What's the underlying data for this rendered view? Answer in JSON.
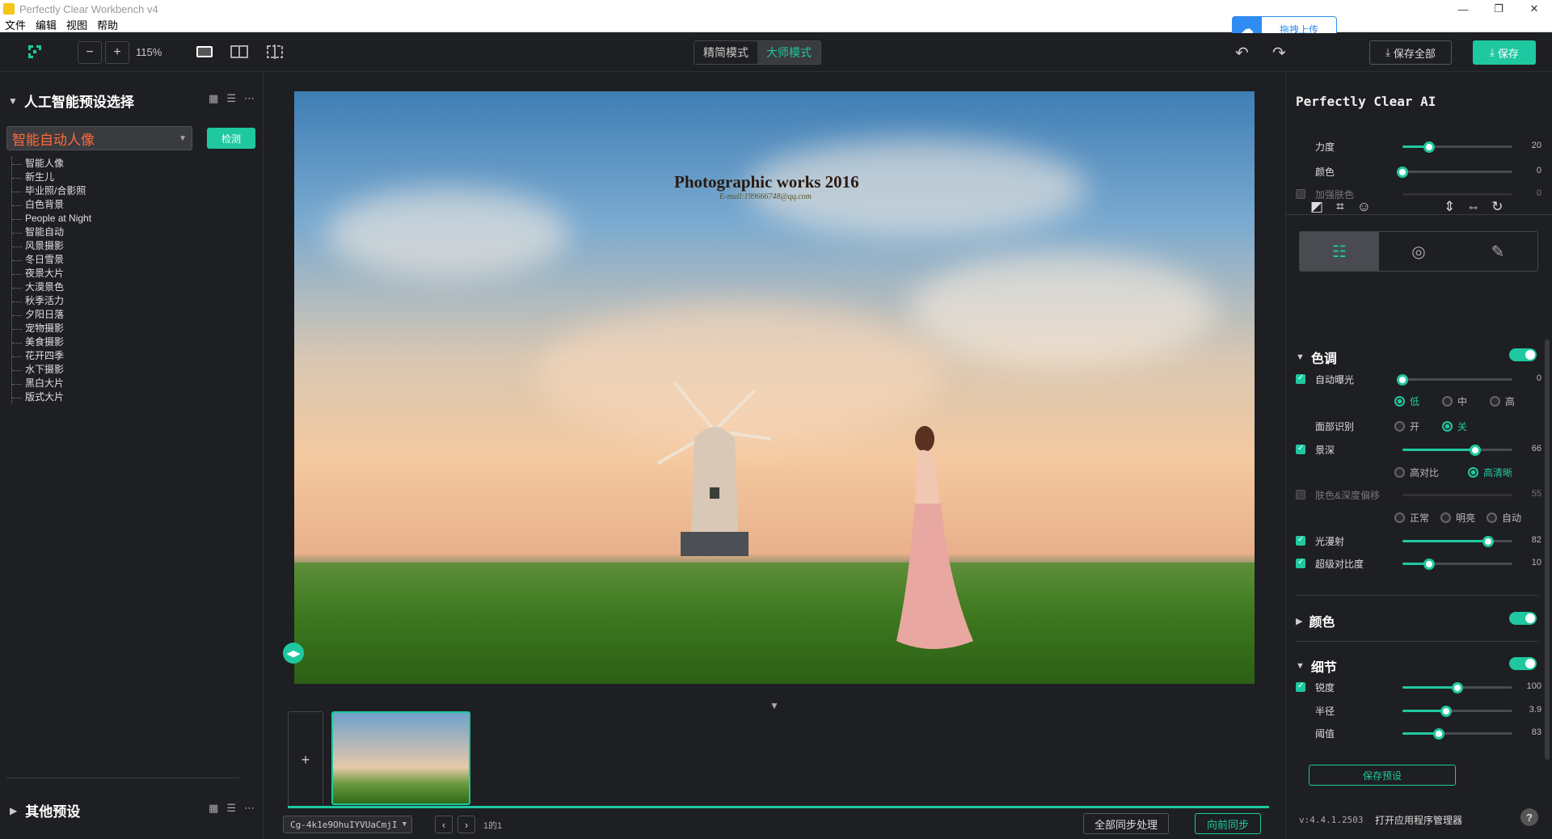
{
  "window": {
    "title": "Perfectly Clear Workbench v4",
    "minimize": "—",
    "restore": "❐",
    "close": "✕"
  },
  "menu": [
    "文件",
    "编辑",
    "视图",
    "帮助"
  ],
  "baidu": {
    "label": "拖拽上传"
  },
  "toolbar": {
    "zoom": "115%",
    "mode_simple": "精简模式",
    "mode_master": "大师模式",
    "save_all": "保存全部",
    "save": "保存"
  },
  "left": {
    "header": "人工智能预设选择",
    "selected_preset": "智能自动人像",
    "detect": "检测",
    "presets": [
      "智能人像",
      "新生儿",
      "毕业照/合影照",
      "白色背景",
      "People at Night",
      "智能自动",
      "风景摄影",
      "冬日雪景",
      "夜景大片",
      "大漠景色",
      "秋季活力",
      "夕阳日落",
      "宠物摄影",
      "美食摄影",
      "花开四季",
      "水下摄影",
      "黑白大片",
      "版式大片"
    ],
    "other_presets": "其他预设"
  },
  "center": {
    "watermark_line1": "Photographic works 2016",
    "watermark_line2": "E-mail:199666748@qq.com",
    "filename": "Cg-4k1e9OhuIYVUaCmjI",
    "page": "1的1",
    "sync_all": "全部同步处理",
    "sync_forward": "向前同步"
  },
  "right": {
    "title": "Perfectly Clear AI",
    "ai": [
      {
        "label": "力度",
        "value": 20,
        "checkbox": null,
        "enabled": true
      },
      {
        "label": "颜色",
        "value": 0,
        "checkbox": null,
        "enabled": true
      },
      {
        "label": "加强肤色",
        "value": 0,
        "checkbox": false,
        "enabled": false
      }
    ],
    "sections": {
      "tone": "色调",
      "color": "颜色",
      "detail": "细节"
    },
    "tone": {
      "auto_exposure": {
        "label": "自动曝光",
        "value": 0
      },
      "exposure_levels": [
        "低",
        "中",
        "高"
      ],
      "face_detect": {
        "label": "面部识别",
        "on": "开",
        "off": "关"
      },
      "depth": {
        "label": "景深",
        "value": 66
      },
      "depth_modes": [
        "高对比",
        "高清晰"
      ],
      "skin_depth": {
        "label": "肤色&深度偏移",
        "value": 55
      },
      "skin_modes": [
        "正常",
        "明亮",
        "自动"
      ],
      "light_diffusion": {
        "label": "光漫射",
        "value": 82
      },
      "super_contrast": {
        "label": "超级对比度",
        "value": 10
      }
    },
    "detail": {
      "sharpness": {
        "label": "锐度",
        "value": 100
      },
      "radius": {
        "label": "半径",
        "value": "3.9"
      },
      "threshold": {
        "label": "阈值",
        "value": 83
      }
    },
    "save_preset": "保存预设",
    "version": "v:4.4.1.2503",
    "open_manager": "打开应用程序管理器",
    "help": "?"
  },
  "colors": {
    "accent": "#1fc8a0",
    "preset_text": "#ff6a3d",
    "background": "#1e1f22"
  }
}
